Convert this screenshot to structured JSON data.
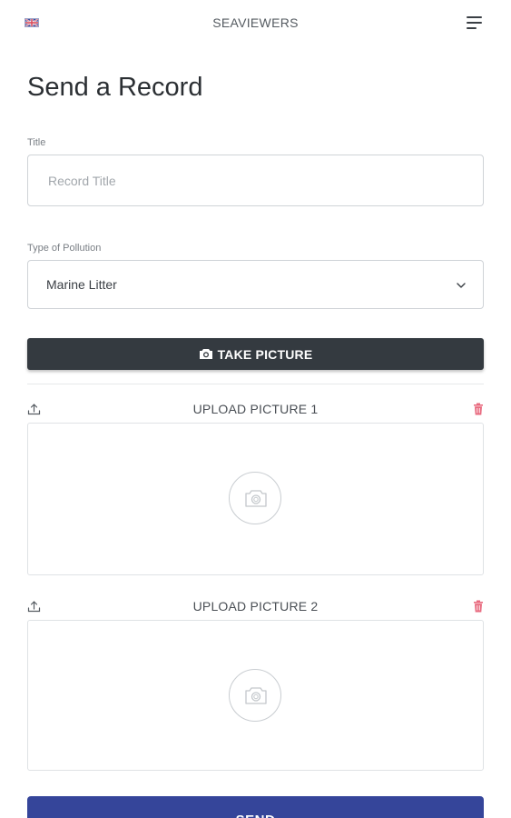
{
  "header": {
    "language_flag": "uk-flag-icon",
    "brand": "SEAVIEWERS",
    "menu_icon": "hamburger-menu-icon"
  },
  "page_title": "Send a Record",
  "form": {
    "title_label": "Title",
    "title_placeholder": "Record Title",
    "title_value": "",
    "pollution_label": "Type of Pollution",
    "pollution_selected": "Marine Litter"
  },
  "take_picture": {
    "icon": "camera-icon",
    "label": "TAKE PICTURE"
  },
  "uploads": [
    {
      "label": "UPLOAD PICTURE 1",
      "upload_icon": "upload-icon",
      "delete_icon": "trash-icon",
      "placeholder_icon": "camera-icon"
    },
    {
      "label": "UPLOAD PICTURE 2",
      "upload_icon": "upload-icon",
      "delete_icon": "trash-icon",
      "placeholder_icon": "camera-icon"
    }
  ],
  "send_button": "SEND",
  "colors": {
    "dark_button": "#343a40",
    "send_button": "#35459a",
    "delete_icon": "#e86a7f"
  }
}
